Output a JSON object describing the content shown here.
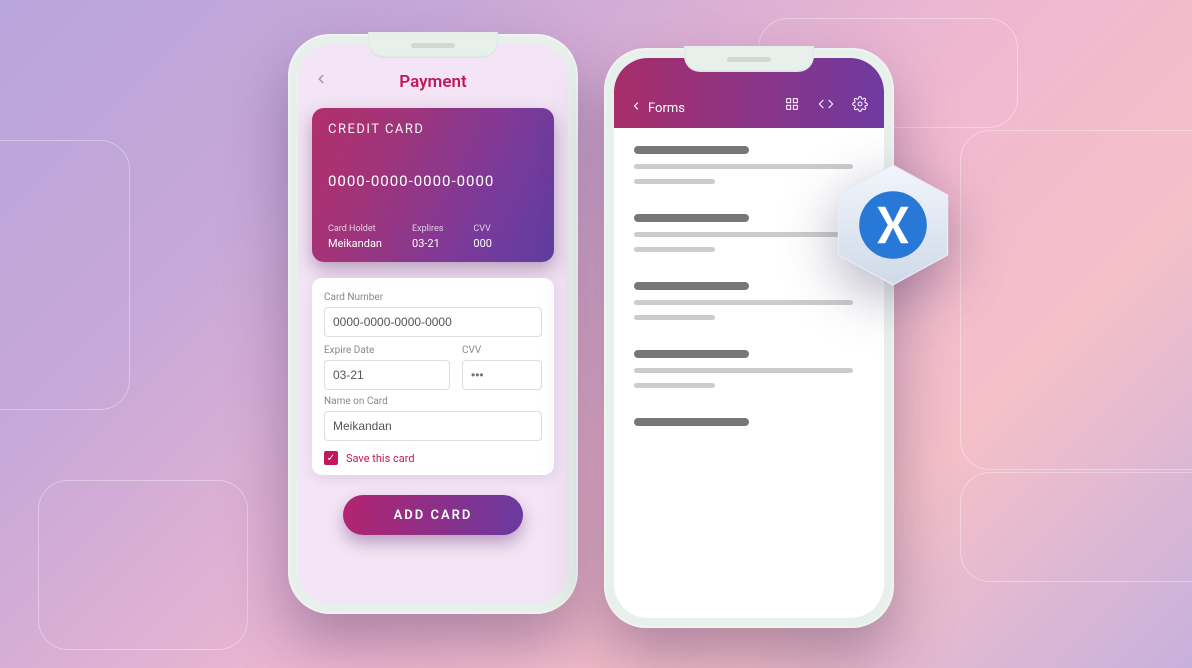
{
  "payment": {
    "title": "Payment",
    "card": {
      "title": "CREDIT CARD",
      "number": "0000-0000-0000-0000",
      "holder_label": "Card Holdet",
      "holder_value": "Meikandan",
      "expires_label": "Explires",
      "expires_value": "03-21",
      "cvv_label": "CVV",
      "cvv_value": "000"
    },
    "form": {
      "card_number_label": "Card Number",
      "card_number_value": "0000-0000-0000-0000",
      "expire_label": "Expire Date",
      "expire_value": "03-21",
      "cvv_label": "CVV",
      "cvv_placeholder": "•••",
      "name_label": "Name on Card",
      "name_value": "Meikandan",
      "save_label": "Save this card"
    },
    "add_button": "ADD CARD"
  },
  "forms": {
    "title": "Forms"
  }
}
